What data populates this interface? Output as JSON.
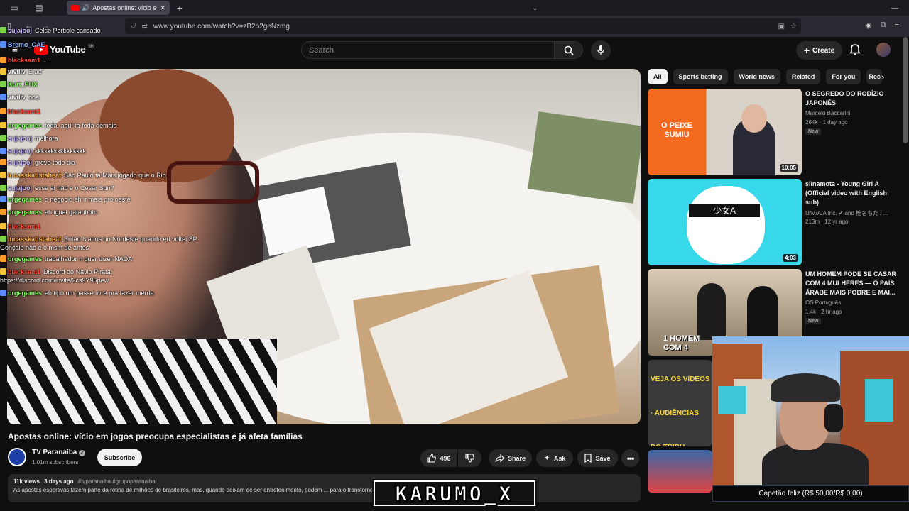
{
  "browser": {
    "tab_title": "Apostas online: vício em jogos",
    "url": "www.youtube.com/watch?v=zB2o2geNzmg"
  },
  "youtube": {
    "logo_text": "YouTube",
    "region": "BR",
    "search_placeholder": "Search",
    "create_label": "Create"
  },
  "chat": [
    {
      "user": "sujajooj",
      "msg": "Celso Portiole cansado",
      "user_color": "#c9b6ff"
    },
    {
      "user": "Bremo_CAE",
      "msg": "",
      "user_color": "#8fb6ff"
    },
    {
      "user": "blacksam1",
      "msg": "...",
      "user_color": "#ff4a3a"
    },
    {
      "user": "viviliv",
      "msg": "E ae",
      "user_color": "#ffffff"
    },
    {
      "user": "Kurt_PHX",
      "msg": "",
      "user_color": "#7fff5a"
    },
    {
      "user": "viviliv",
      "msg": "boa",
      "user_color": "#ffffff"
    },
    {
      "user": "blacksam1",
      "msg": "",
      "user_color": "#ff4a3a"
    },
    {
      "user": "urgegames",
      "msg": "foda, aqui ta foda demais",
      "user_color": "#7fff5a"
    },
    {
      "user": "sujajooj",
      "msg": "melhora",
      "user_color": "#c9b6ff"
    },
    {
      "user": "sujajooj",
      "msg": "kkkkkkkkkkkkkkkk",
      "user_color": "#c9b6ff"
    },
    {
      "user": "sujajooj",
      "msg": "greve todo dia",
      "user_color": "#c9b6ff"
    },
    {
      "user": "lucasskatistabeat",
      "msg": "São Paulo tá Mais jogado que o Rio",
      "user_color": "#ffb347"
    },
    {
      "user": "sujajooj",
      "msg": "esse aí não é o Cesar Sun?",
      "user_color": "#c9b6ff"
    },
    {
      "user": "urgegames",
      "msg": "o negocio eh ir mais pro oeste",
      "user_color": "#7fff5a"
    },
    {
      "user": "urgegames",
      "msg": "eh igual gafanhoto",
      "user_color": "#7fff5a"
    },
    {
      "user": "blacksam1",
      "msg": "",
      "user_color": "#ff4a3a"
    },
    {
      "user": "lucasskatistabeat",
      "msg": "Então 8 anos no Nordeste quando eu voltei SP",
      "user_color": "#ffb347"
    },
    {
      "user": "",
      "msg": "Gonçalo não é o msm de antes",
      "user_color": "#ffffff"
    },
    {
      "user": "urgegames",
      "msg": "trabalhador n quer dizer NADA",
      "user_color": "#7fff5a"
    },
    {
      "user": "blacksam1",
      "msg": "Discord do Navio Pirata:",
      "user_color": "#ff4a3a"
    },
    {
      "user": "",
      "msg": "https://discord.com/invite/2cs9Y95pew",
      "user_color": "#ffffff"
    },
    {
      "user": "urgegames",
      "msg": "eh tipo um passe livre pra fazer merda",
      "user_color": "#7fff5a"
    }
  ],
  "video": {
    "title": "Apostas online: vício em jogos preocupa especialistas e já afeta famílias",
    "channel": "TV Paranaíba",
    "subscribers": "1.01m subscribers",
    "subscribe_label": "Subscribe",
    "likes": "496",
    "share_label": "Share",
    "ask_label": "Ask",
    "save_label": "Save",
    "views": "11k views",
    "date": "3 days ago",
    "hashtags": "#tvparanaiba #grupoparanaiba",
    "description_line": "As apostas esportivas fazem parte da rotina de milhões de brasileiros, mas, quando deixam de ser entretenimento, podem ... para o transtorno do vício em"
  },
  "chips": [
    "All",
    "Sports betting",
    "World news",
    "Related",
    "For you",
    "Rec"
  ],
  "related": [
    {
      "title": "O SEGREDO DO RODÍZIO JAPONÊS",
      "channel": "Marcelo Baccarini",
      "meta": "264k · 1 day ago",
      "badge": "New",
      "duration": "10:05",
      "thumb_text": "O PEIXE SUMIU"
    },
    {
      "title": "siinamota - Young Girl A (Official video with English sub)",
      "channel": "U/M/A/A Inc. ✔ and 椎名もた / ...",
      "meta": "213m · 12 yr ago",
      "badge": "",
      "duration": "4:03",
      "thumb_text": "少女A"
    },
    {
      "title": "UM HOMEM PODE SE CASAR COM 4 MULHERES — O PAÍS ÁRABE MAIS POBRE E MAI...",
      "channel": "OS Português",
      "meta": "1.4k · 2 hr ago",
      "badge": "New",
      "duration": "",
      "thumb_text": "1 HOMEM COM 4"
    },
    {
      "title": "",
      "channel": "",
      "meta": "",
      "badge": "",
      "duration": "",
      "thumb_text": "VEJA OS VÍDEOS · AUDIÊNCIAS DO TRIBU"
    }
  ],
  "overlay": {
    "donation_text": "Capetão feliz (R$ 50,00/R$ 0,00)",
    "streamer_logo": "KARUMO_X"
  }
}
